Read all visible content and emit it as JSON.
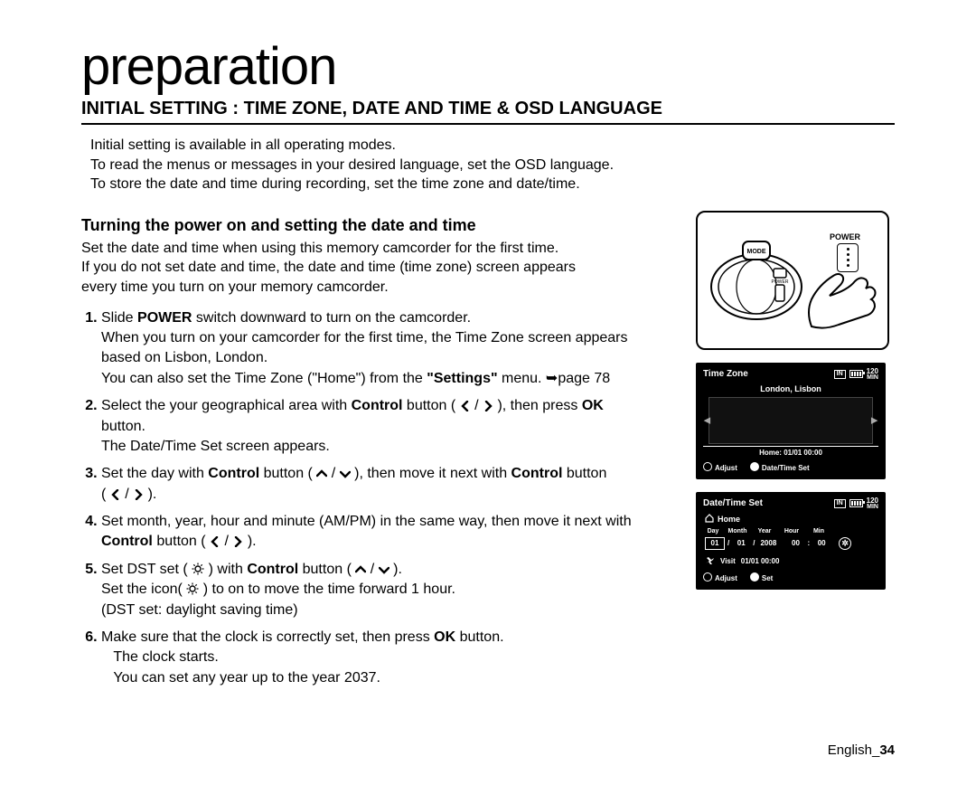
{
  "title": "preparation",
  "section_heading": "INITIAL SETTING : TIME ZONE, DATE AND TIME & OSD LANGUAGE",
  "intro": {
    "l1": "Initial setting is available in all operating modes.",
    "l2": "To read the menus or messages in your desired language, set the OSD language.",
    "l3": "To store the date and time during recording, set the time zone and date/time."
  },
  "sub_heading": "Turning the power on and setting the date and time",
  "para": {
    "l1": "Set the date and time when using this memory camcorder for the first time.",
    "l2": "If you do not set date and time, the date and time (time zone) screen appears",
    "l3": "every time you turn on your memory camcorder."
  },
  "steps": {
    "s1a": "Slide ",
    "s1b": "POWER",
    "s1c": " switch downward to turn on the camcorder.",
    "s1d": "When you turn on your camcorder for the first time, the Time Zone screen appears",
    "s1e": "based on Lisbon, London.",
    "s1f": "You can also set the Time Zone (\"Home\") from the ",
    "s1g": "\"Settings\"",
    "s1h": " menu. ➥page 78",
    "s2a": "Select the your geographical area with ",
    "s2b": "Control",
    "s2c": " button ( ",
    "s2d": " / ",
    "s2e": " ), then press ",
    "s2f": "OK",
    "s2g": " button.",
    "s2h": "The Date/Time Set screen appears.",
    "s3a": "Set the day with ",
    "s3b": "Control",
    "s3c": " button ( ",
    "s3d": " / ",
    "s3e": " ), then move it next with ",
    "s3f": "Control",
    "s3g": " button",
    "s3h": "( ",
    "s3i": " / ",
    "s3j": " ).",
    "s4a": "Set month, year, hour and minute (AM/PM) in the same way, then move it next with",
    "s4b": "Control",
    "s4c": " button ( ",
    "s4d": " / ",
    "s4e": " ).",
    "s5a": "Set DST set ( ",
    "s5b": " ) with ",
    "s5c": "Control",
    "s5d": " button ( ",
    "s5e": " / ",
    "s5f": " ).",
    "s5g": "Set the icon( ",
    "s5h": " ) to on to move the time forward 1 hour.",
    "s5i": "(DST set: daylight saving time)",
    "s6a": "Make sure that the clock is correctly set, then press ",
    "s6b": "OK",
    "s6c": " button.",
    "s6d": "The clock starts.",
    "s6e": "You can set any year up to the year 2037."
  },
  "fig": {
    "power_label": "POWER"
  },
  "osd1": {
    "title": "Time Zone",
    "in": "IN",
    "min_num": "120",
    "min_unit": "MIN",
    "city": "London, Lisbon",
    "home_line": "Home: 01/01 00:00",
    "adjust": "Adjust",
    "set": "Date/Time Set"
  },
  "osd2": {
    "title": "Date/Time Set",
    "in": "IN",
    "min_num": "120",
    "min_unit": "MIN",
    "home": "Home",
    "labels": {
      "day": "Day",
      "month": "Month",
      "year": "Year",
      "hour": "Hour",
      "min": "Min"
    },
    "date": {
      "day": "01",
      "month": "01",
      "year": "2008",
      "hour": "00",
      "min": "00"
    },
    "visit": "Visit",
    "visit_time": "01/01  00:00",
    "adjust": "Adjust",
    "set": "Set"
  },
  "footer": {
    "lang": "English",
    "sep": "_",
    "num": "34"
  }
}
